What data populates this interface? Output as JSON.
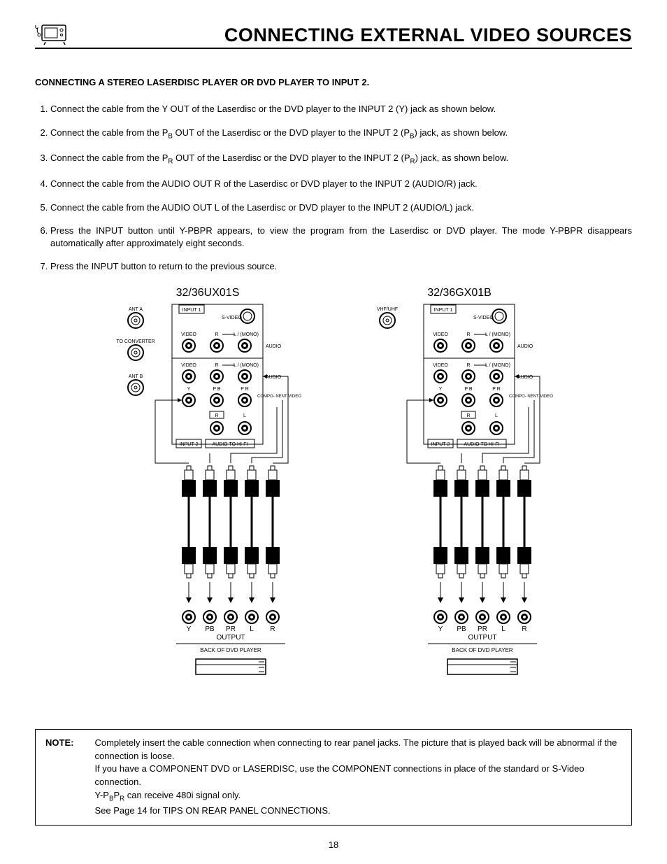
{
  "header": {
    "title": "CONNECTING EXTERNAL VIDEO SOURCES"
  },
  "section_heading": "CONNECTING A STEREO LASERDISC PLAYER OR DVD PLAYER TO INPUT 2.",
  "steps": {
    "s1": "Connect the cable from the Y OUT of the Laserdisc or the DVD player to the INPUT 2 (Y) jack as shown below.",
    "s2a": "Connect the cable from the P",
    "s2b": " OUT of the Laserdisc or the DVD player to the INPUT 2 (P",
    "s2c": ") jack, as shown below.",
    "s3a": "Connect the cable from the P",
    "s3b": " OUT of the Laserdisc or the DVD player to the INPUT 2 (P",
    "s3c": ") jack, as shown below.",
    "s4": "Connect the cable from the AUDIO OUT R of the Laserdisc or DVD player to the INPUT 2 (AUDIO/R) jack.",
    "s5": "Connect the cable from the AUDIO OUT L of the Laserdisc or DVD player to the INPUT 2 (AUDIO/L) jack.",
    "s6": "Press the INPUT button until Y-PBPR appears, to view the program from the Laserdisc or DVD player. The mode Y-PBPR disappears automatically after approximately eight seconds.",
    "s7": "Press the INPUT button to return to the previous source."
  },
  "sub_labels": {
    "B": "B",
    "R": "R"
  },
  "diagrams": {
    "left_title": "32/36UX01S",
    "right_title": "32/36GX01B",
    "labels": {
      "ant_a": "ANT A",
      "to_converter": "TO CONVERTER",
      "ant_b": "ANT B",
      "vhf_uhf": "VHF/UHF",
      "input1": "INPUT 1",
      "input2": "INPUT 2",
      "svideo": "S-VIDEO",
      "video": "VIDEO",
      "r": "R",
      "l_mono": "L / (MONO)",
      "audio": "AUDIO",
      "y": "Y",
      "pb": "P B",
      "pr": "P R",
      "PB": "PB",
      "PR": "PR",
      "L": "L",
      "Rc": "R",
      "component": "COMPO-\nNENT\nVIDEO",
      "l": "L",
      "audio_to_hifi": "AUDIO TO HI-FI",
      "output": "OUTPUT",
      "back_of_dvd": "BACK OF DVD PLAYER"
    }
  },
  "note": {
    "label": "NOTE:",
    "line1": "Completely insert the cable connection when connecting to rear panel jacks. The picture that is played back will be abnormal if the connection is loose.",
    "line2": "If you have a COMPONENT DVD or LASERDISC, use the COMPONENT connections in place of the standard or S-Video connection.",
    "line3a": "Y-P",
    "line3b": "P",
    "line3c": " can receive 480i signal only.",
    "line4": "See Page 14 for TIPS ON REAR PANEL CONNECTIONS."
  },
  "page_number": "18"
}
